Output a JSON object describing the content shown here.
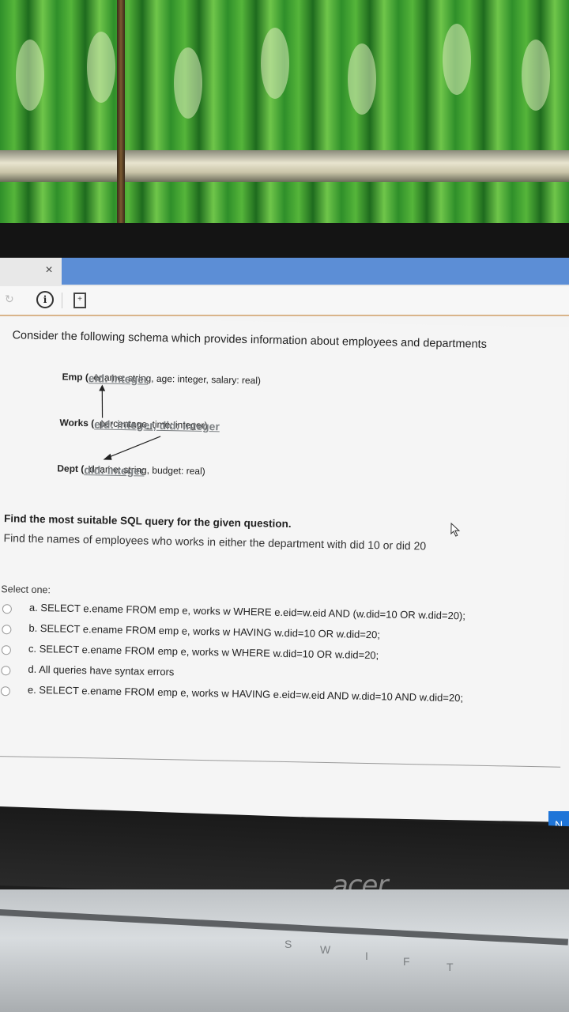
{
  "browser": {
    "tab_close": "×",
    "info_icon_glyph": "i",
    "page_icon_glyph": "+"
  },
  "question": {
    "intro": "Consider the following schema which provides information about employees and departments",
    "schema": [
      {
        "name": "Emp",
        "key": "eid: integer",
        "rest": ", ename: string, age: integer, salary: real)"
      },
      {
        "name": "Works",
        "key": "eid: integer, did: integer",
        "rest": ", percentage_time: integer)"
      },
      {
        "name": "Dept",
        "key": "did: integer",
        "rest": ", dname: string, budget: real)"
      }
    ],
    "title": "Find the most suitable SQL query for the given question.",
    "text": "Find the names of employees who works in either the department with did 10 or did 20",
    "select_label": "Select one:",
    "options": [
      "a. SELECT e.ename FROM emp e, works w WHERE e.eid=w.eid AND (w.did=10 OR w.did=20);",
      "b. SELECT e.ename FROM emp e, works w HAVING w.did=10 OR w.did=20;",
      "c. SELECT e.ename FROM emp e, works w WHERE w.did=10 OR w.did=20;",
      "d. All queries have syntax errors",
      "e. SELECT e.ename FROM emp e, works w HAVING e.eid=w.eid AND w.did=10 AND w.did=20;"
    ]
  },
  "next_button": "N",
  "laptop": {
    "brand": "acer",
    "keys": [
      "S",
      "W",
      "I",
      "F",
      "T"
    ]
  },
  "colors": {
    "accent": "#5c8ed6",
    "next_button": "#1f75d8"
  }
}
